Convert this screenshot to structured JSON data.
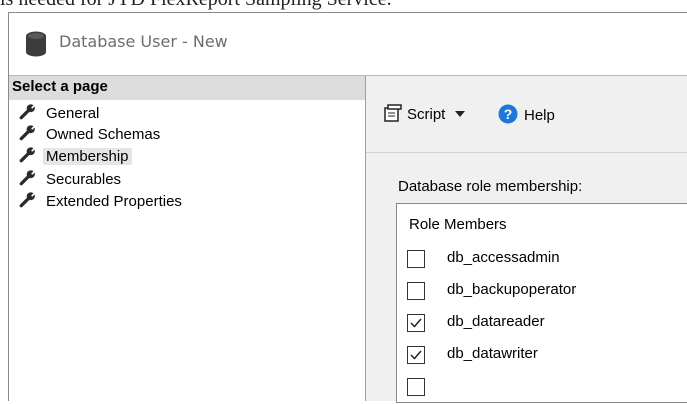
{
  "document": {
    "caption": "is needed for JYD FlexReport Sampling Service."
  },
  "window": {
    "title": "Database User - New"
  },
  "sidebar": {
    "header": "Select a page",
    "items": [
      {
        "label": "General",
        "selected": false
      },
      {
        "label": "Owned Schemas",
        "selected": false
      },
      {
        "label": "Membership",
        "selected": true
      },
      {
        "label": "Securables",
        "selected": false
      },
      {
        "label": "Extended Properties",
        "selected": false
      }
    ]
  },
  "toolbar": {
    "script_label": "Script",
    "help_label": "Help"
  },
  "membership": {
    "section_label": "Database role membership:",
    "list_header": "Role Members",
    "roles": [
      {
        "name": "db_accessadmin",
        "checked": false
      },
      {
        "name": "db_backupoperator",
        "checked": false
      },
      {
        "name": "db_datareader",
        "checked": true
      },
      {
        "name": "db_datawriter",
        "checked": true
      }
    ]
  },
  "colors": {
    "selected_item_bg": "#e5e5e5",
    "header_bg": "#dcdcdc",
    "help_icon_blue": "#1e78d7"
  }
}
